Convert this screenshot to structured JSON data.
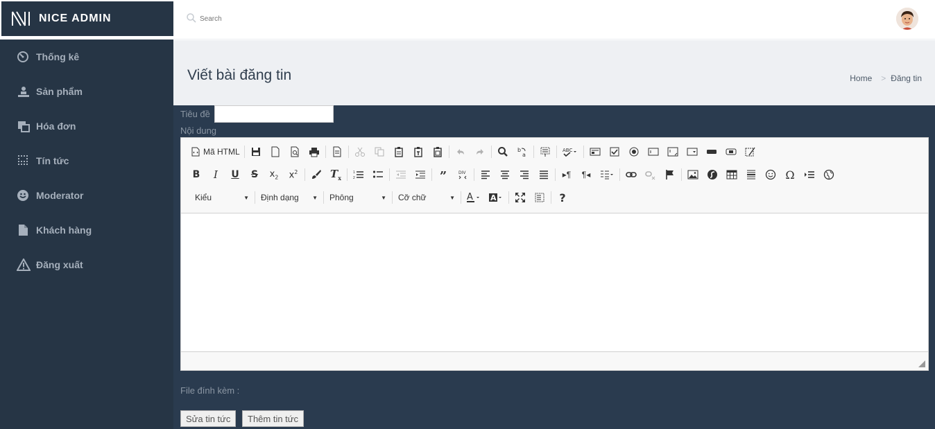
{
  "app": {
    "name": "NICE ADMIN"
  },
  "search": {
    "placeholder": "Search"
  },
  "sidebar": {
    "items": [
      {
        "label": "Thống kê",
        "icon": "dashboard-icon"
      },
      {
        "label": "Sản phẩm",
        "icon": "person-icon"
      },
      {
        "label": "Hóa đơn",
        "icon": "copy-icon"
      },
      {
        "label": "Tín tức",
        "icon": "grid-dots-icon"
      },
      {
        "label": "Moderator",
        "icon": "smile-icon"
      },
      {
        "label": "Khách hàng",
        "icon": "file-icon"
      },
      {
        "label": "Đăng xuất",
        "icon": "warning-icon"
      }
    ]
  },
  "page": {
    "title": "Viết bài đăng tin"
  },
  "breadcrumb": {
    "home": "Home",
    "current": "Đăng tin"
  },
  "form": {
    "title_label": "Tiêu đề",
    "title_value": "",
    "content_label": "Nội dung",
    "attachment_label": "File đính kèm :",
    "edit_button": "Sửa tin tức",
    "add_button": "Thêm tin tức"
  },
  "editor": {
    "source_label": "Mã HTML",
    "styles_label": "Kiểu",
    "format_label": "Định dạng",
    "font_label": "Phông",
    "size_label": "Cỡ chữ",
    "help_label": "?"
  },
  "colors": {
    "sidebar": "#263545",
    "content": "#2a3b4f",
    "header": "#eef0f3"
  }
}
